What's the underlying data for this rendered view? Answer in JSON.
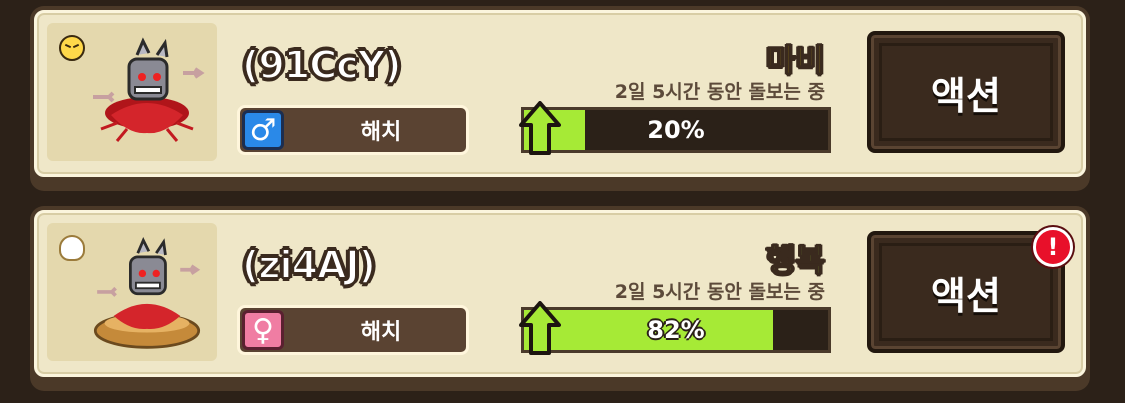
{
  "pets": [
    {
      "name": "(91CcY)",
      "status_icon": "angry-face-icon",
      "gender": "male",
      "gender_symbol": "♂",
      "stage": "해치",
      "mood": "마비",
      "mood_color": "#ffe400",
      "care_text": "2일 5시간 동안 돌보는 중",
      "progress_value": 0.2,
      "progress_text": "20%",
      "action_label": "액션",
      "has_alert": false
    },
    {
      "name": "(zi4AJ)",
      "status_icon": "egg-in-nest-icon",
      "gender": "female",
      "gender_symbol": "♀",
      "stage": "해치",
      "mood": "행복",
      "mood_color": "#9ee23a",
      "care_text": "2일 5시간 동안 돌보는 중",
      "progress_value": 0.82,
      "progress_text": "82%",
      "action_label": "액션",
      "has_alert": true,
      "alert_symbol": "!"
    }
  ]
}
